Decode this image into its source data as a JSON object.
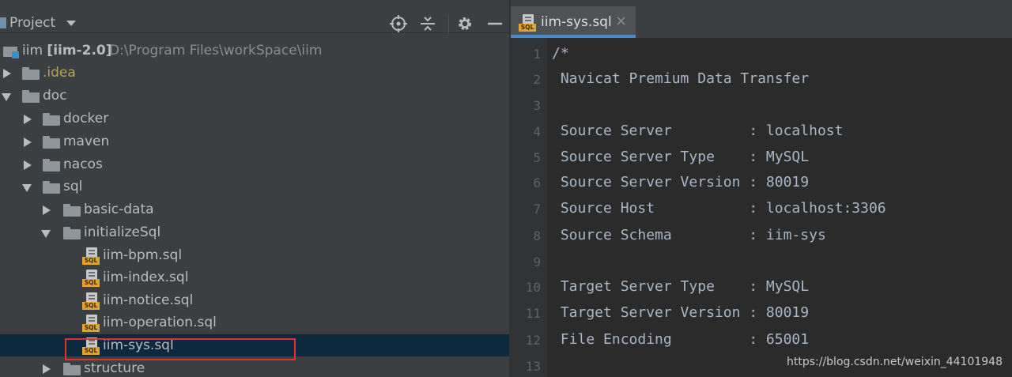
{
  "project_panel": {
    "title": "Project",
    "root": {
      "name": "iim",
      "module": "[iim-2.0]",
      "path": "D:\\Program Files\\workSpace\\iim"
    },
    "tree": [
      {
        "label": ".idea",
        "kind": "folder",
        "expanded": false
      },
      {
        "label": "doc",
        "kind": "folder",
        "expanded": true
      },
      {
        "label": "docker",
        "kind": "folder",
        "expanded": false
      },
      {
        "label": "maven",
        "kind": "folder",
        "expanded": false
      },
      {
        "label": "nacos",
        "kind": "folder",
        "expanded": false
      },
      {
        "label": "sql",
        "kind": "folder",
        "expanded": true
      },
      {
        "label": "basic-data",
        "kind": "folder",
        "expanded": false
      },
      {
        "label": "initializeSql",
        "kind": "folder",
        "expanded": true
      },
      {
        "label": "iim-bpm.sql",
        "kind": "sql-file"
      },
      {
        "label": "iim-index.sql",
        "kind": "sql-file"
      },
      {
        "label": "iim-notice.sql",
        "kind": "sql-file"
      },
      {
        "label": "iim-operation.sql",
        "kind": "sql-file"
      },
      {
        "label": "iim-sys.sql",
        "kind": "sql-file",
        "selected": true
      },
      {
        "label": "structure",
        "kind": "folder",
        "expanded": false
      }
    ],
    "toolbar_icons": [
      "crosshair-icon",
      "collapse-icon",
      "gear-icon",
      "minimize-icon"
    ]
  },
  "editor": {
    "tab": {
      "label": "iim-sys.sql",
      "close": "×",
      "icon_text": "SQL"
    },
    "lines": [
      {
        "n": "1",
        "text": "/*"
      },
      {
        "n": "2",
        "text": " Navicat Premium Data Transfer"
      },
      {
        "n": "3",
        "text": ""
      },
      {
        "n": "4",
        "text": " Source Server         : localhost"
      },
      {
        "n": "5",
        "text": " Source Server Type    : MySQL"
      },
      {
        "n": "6",
        "text": " Source Server Version : 80019"
      },
      {
        "n": "7",
        "text": " Source Host           : localhost:3306"
      },
      {
        "n": "8",
        "text": " Source Schema         : iim-sys"
      },
      {
        "n": "9",
        "text": ""
      },
      {
        "n": "10",
        "text": " Target Server Type    : MySQL"
      },
      {
        "n": "11",
        "text": " Target Server Version : 80019"
      },
      {
        "n": "12",
        "text": " File Encoding         : 65001"
      },
      {
        "n": "13",
        "text": ""
      }
    ]
  },
  "watermark": "https://blog.csdn.net/weixin_44101948",
  "colors": {
    "selection": "#0d293e",
    "highlight_box": "#e0312f",
    "tab_underline": "#4a88c7",
    "sql_badge": "#e0a433"
  }
}
